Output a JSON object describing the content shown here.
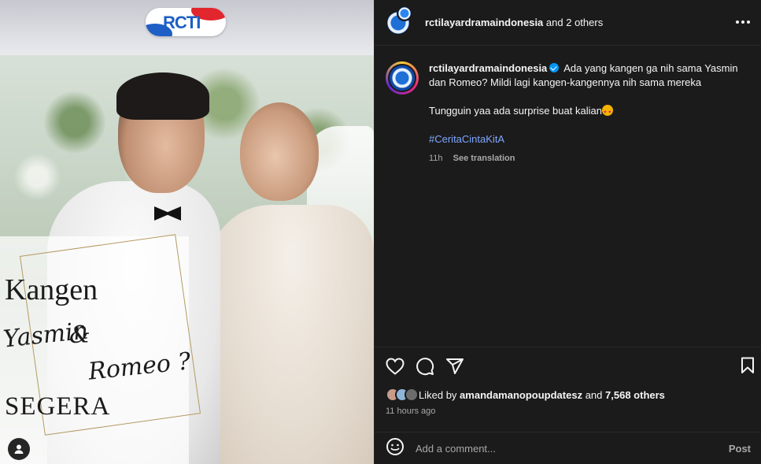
{
  "media": {
    "logo_text": "RCTI",
    "overlay": {
      "line1": "Kangen",
      "line2a": "Yasmin",
      "line2b": "&",
      "line3": "Romeo ?",
      "line4": "SEGERA"
    },
    "tag_icon": "user-icon"
  },
  "header": {
    "username": "rctilayardramaindonesia",
    "others": "and 2 others",
    "more_icon": "more-horizontal-icon"
  },
  "caption": {
    "username": "rctilayardramaindonesia",
    "text1": "Ada yang kangen ga nih sama Yasmin dan Romeo? Mildi lagi kangen-kangennya nih sama mereka",
    "text2": "Tungguin yaa ada surprise buat kalian",
    "hashtag": "#CeritaCintaKitA",
    "time": "11h",
    "translate": "See translation"
  },
  "actions": {
    "like_icon": "heart-icon",
    "comment_icon": "comment-icon",
    "share_icon": "share-icon",
    "save_icon": "bookmark-icon"
  },
  "likes": {
    "prefix": "Liked by",
    "user": "amandamanopoupdatesz",
    "and": "and",
    "count": "7,568 others"
  },
  "timeago": "11 hours ago",
  "comment": {
    "emoji_icon": "emoji-icon",
    "placeholder": "Add a comment...",
    "post_label": "Post"
  },
  "colors": {
    "panel_bg": "#1b1b1b",
    "hashtag": "#7ea7ff",
    "verified": "#0095f6",
    "muted": "#a8a8a8"
  }
}
